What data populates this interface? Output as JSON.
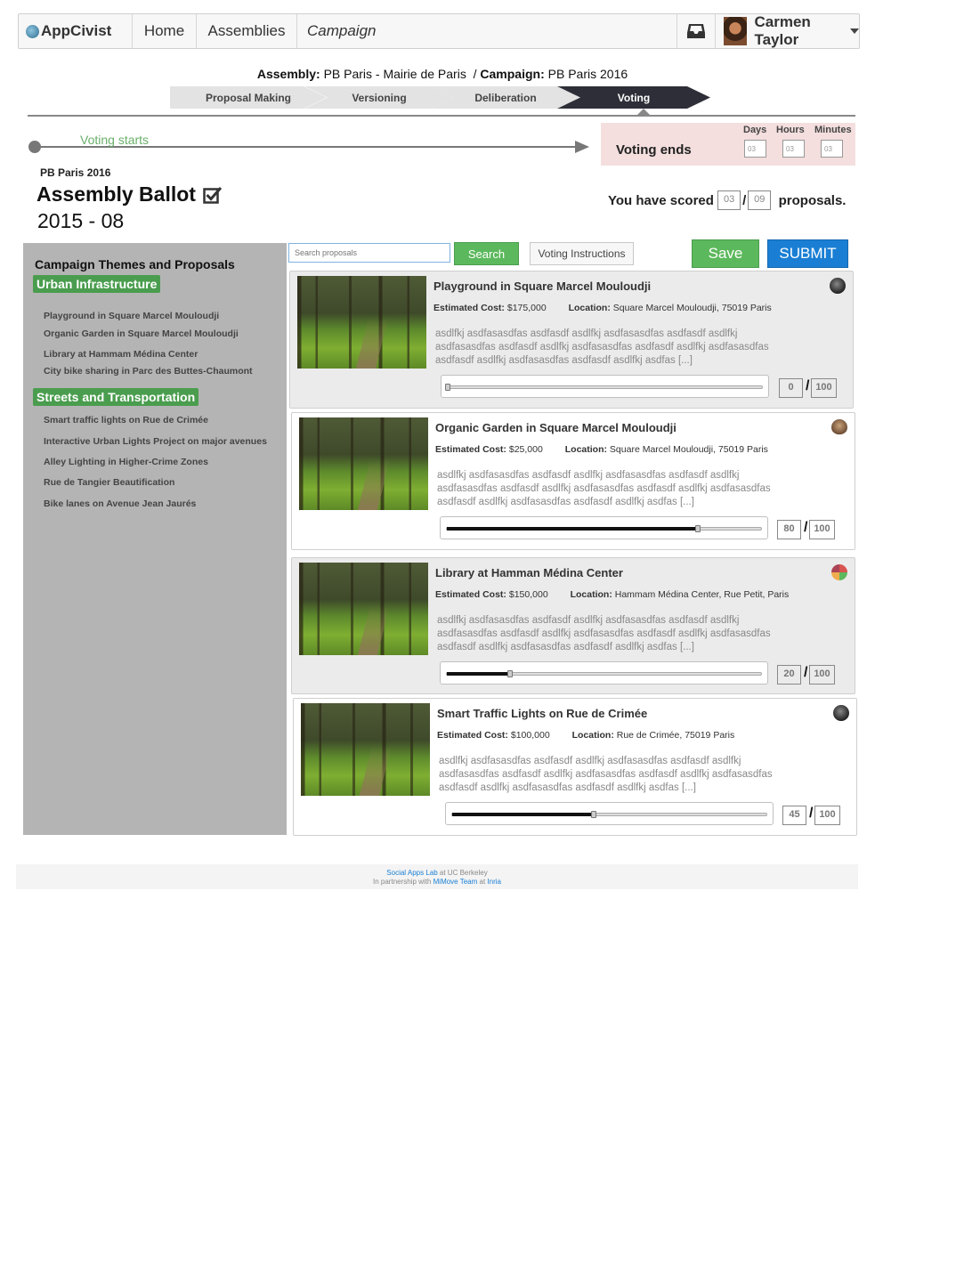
{
  "nav": {
    "logo": "AppCivist",
    "home": "Home",
    "assemblies": "Assemblies",
    "campaign": "Campaign",
    "user_name": "Carmen Taylor"
  },
  "breadcrumb": {
    "assembly_label": "Assembly:",
    "assembly_value": "PB Paris - Mairie de Paris",
    "separator": "/",
    "campaign_label": "Campaign:",
    "campaign_value": "PB Paris 2016"
  },
  "phases": [
    "Proposal Making",
    "Versioning",
    "Deliberation",
    "Voting"
  ],
  "active_phase": "Voting",
  "timeline": {
    "start_label": "Voting starts",
    "end_label": "Voting ends",
    "countdown_labels": [
      "Days",
      "Hours",
      "Minutes"
    ],
    "countdown_values": [
      "03",
      "03",
      "03"
    ]
  },
  "ballot": {
    "campaign_name": "PB Paris 2016",
    "title": "Assembly Ballot",
    "date": "2015 - 08",
    "score_prefix": "You have scored",
    "scored": "03",
    "slash": "/",
    "total": "09",
    "score_suffix": "proposals."
  },
  "sidebar": {
    "heading": "Campaign Themes and Proposals",
    "themes": [
      {
        "name": "Urban Infrastructure",
        "items": [
          "Playground in Square Marcel Mouloudji",
          "Organic Garden in Square Marcel Mouloudji",
          "Library at Hammam Médina Center",
          "City bike sharing in Parc des Buttes-Chaumont"
        ]
      },
      {
        "name": "Streets and Transportation",
        "items": [
          "Smart traffic lights on Rue de Crimée",
          "Interactive Urban Lights Project on major avenues",
          "Alley Lighting in Higher-Crime Zones",
          "Rue de Tangier Beautification",
          "Bike lanes on Avenue Jean Jaurés"
        ]
      }
    ]
  },
  "toolbar": {
    "search_placeholder": "Search proposals",
    "search_label": "Search",
    "instructions_label": "Voting Instructions",
    "save_label": "Save",
    "submit_label": "SUBMIT"
  },
  "labels": {
    "estimated_cost": "Estimated Cost:",
    "location": "Location:"
  },
  "proposals": [
    {
      "title": "Playground in Square Marcel Mouloudji",
      "cost": "$175,000",
      "location": "Square Marcel Mouloudji, 75019 Paris",
      "description": "asdlfkj asdfasasdfas asdfasdf asdlfkj asdfasasdfas asdfasdf asdlfkj asdfasasdfas asdfasdf asdlfkj asdfasasdfas asdfasdf asdlfkj asdfasasdfas asdfasdf asdlfkj asdfasasdfas asdfasdf asdlfkj asdfas [...]",
      "score": 0,
      "score_label": "0",
      "max": "100",
      "icon": "author-avatar-icon"
    },
    {
      "title": "Organic Garden in Square Marcel Mouloudji",
      "cost": "$25,000",
      "location": "Square Marcel Mouloudji, 75019 Paris",
      "description": "asdlfkj asdfasasdfas asdfasdf asdlfkj asdfasasdfas asdfasdf asdlfkj asdfasasdfas asdfasdf asdlfkj asdfasasdfas asdfasdf asdlfkj asdfasasdfas asdfasdf asdlfkj asdfasasdfas asdfasdf asdlfkj asdfas [...]",
      "score": 80,
      "score_label": "80",
      "max": "100",
      "icon": "author-avatar-icon"
    },
    {
      "title": "Library at Hamman Médina Center",
      "cost": "$150,000",
      "location": "Hammam Médina Center, Rue Petit, Paris",
      "description": "asdlfkj asdfasasdfas asdfasdf asdlfkj asdfasasdfas asdfasdf asdlfkj asdfasasdfas asdfasdf asdlfkj asdfasasdfas asdfasdf asdlfkj asdfasasdfas asdfasdf asdlfkj asdfasasdfas asdfasdf asdlfkj asdfas [...]",
      "score": 20,
      "score_label": "20",
      "max": "100",
      "icon": "author-avatar-icon"
    },
    {
      "title": "Smart Traffic Lights on Rue de Crimée",
      "cost": "$100,000",
      "location": "Rue de Crimée, 75019 Paris",
      "description": "asdlfkj asdfasasdfas asdfasdf asdlfkj asdfasasdfas asdfasdf asdlfkj asdfasasdfas asdfasdf asdlfkj asdfasasdfas asdfasdf asdlfkj asdfasasdfas asdfasdf asdlfkj asdfasasdfas asdfasdf asdlfkj asdfas [...]",
      "score": 45,
      "score_label": "45",
      "max": "100",
      "icon": "author-avatar-icon"
    }
  ],
  "footer": {
    "lab": "Social Apps Lab",
    "at1": "at UC Berkeley",
    "partnership": "In partnership with",
    "team": "MiMove Team",
    "at2": "at",
    "org": "Inria"
  }
}
